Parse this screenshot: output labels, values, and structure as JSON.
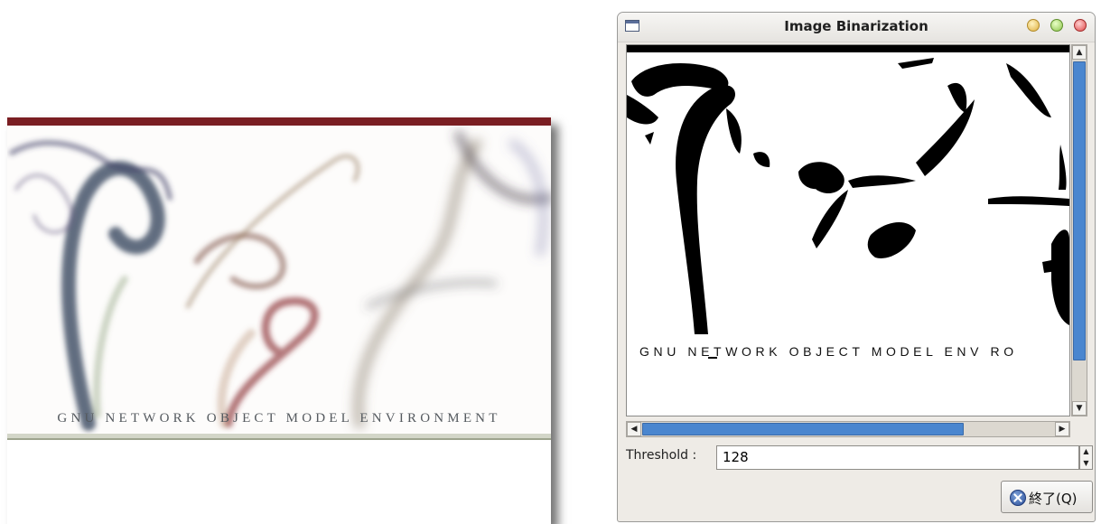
{
  "original_image": {
    "caption": "GNU NETWORK OBJECT MODEL ENVIRONMENT",
    "accent_color": "#7a1e22"
  },
  "window": {
    "title": "Image Binarization",
    "icons": [
      "window-menu-icon",
      "minimize-icon",
      "maximize-icon",
      "close-icon"
    ]
  },
  "binarized_view": {
    "caption": "GNU NETWORK OBJECT MODEL ENV RO",
    "scroll_h": {
      "thumb_fraction": 0.78
    },
    "scroll_v": {
      "thumb_fraction": 0.88
    }
  },
  "threshold": {
    "label": "Threshold :",
    "value": "128"
  },
  "quit_button": {
    "label": "終了(Q)",
    "icon": "stop-icon"
  }
}
